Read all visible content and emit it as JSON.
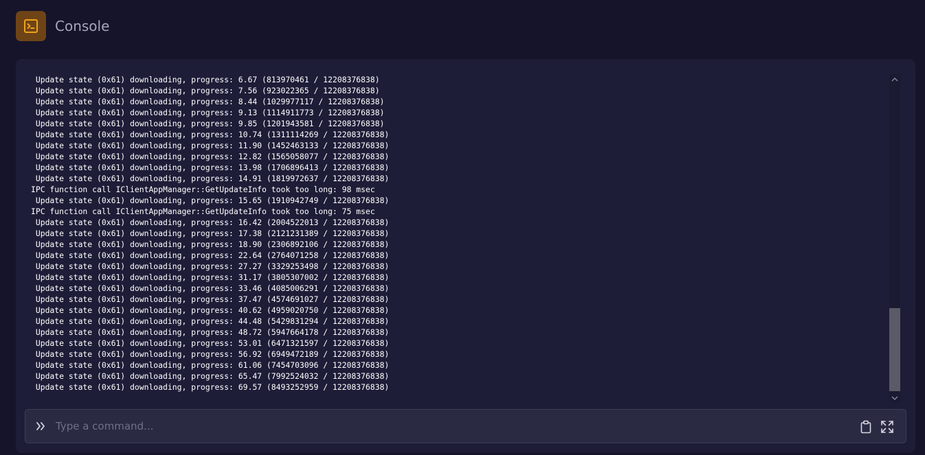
{
  "header": {
    "title": "Console",
    "icon": "terminal-icon"
  },
  "log": {
    "lines": [
      " Update state (0x61) downloading, progress: 6.67 (813970461 / 12208376838)",
      " Update state (0x61) downloading, progress: 7.56 (923022365 / 12208376838)",
      " Update state (0x61) downloading, progress: 8.44 (1029977117 / 12208376838)",
      " Update state (0x61) downloading, progress: 9.13 (1114911773 / 12208376838)",
      " Update state (0x61) downloading, progress: 9.85 (1201943581 / 12208376838)",
      " Update state (0x61) downloading, progress: 10.74 (1311114269 / 12208376838)",
      " Update state (0x61) downloading, progress: 11.90 (1452463133 / 12208376838)",
      " Update state (0x61) downloading, progress: 12.82 (1565058077 / 12208376838)",
      " Update state (0x61) downloading, progress: 13.98 (1706896413 / 12208376838)",
      " Update state (0x61) downloading, progress: 14.91 (1819972637 / 12208376838)",
      "IPC function call IClientAppManager::GetUpdateInfo took too long: 98 msec",
      " Update state (0x61) downloading, progress: 15.65 (1910942749 / 12208376838)",
      "IPC function call IClientAppManager::GetUpdateInfo took too long: 75 msec",
      " Update state (0x61) downloading, progress: 16.42 (2004522013 / 12208376838)",
      " Update state (0x61) downloading, progress: 17.38 (2121231389 / 12208376838)",
      " Update state (0x61) downloading, progress: 18.90 (2306892106 / 12208376838)",
      " Update state (0x61) downloading, progress: 22.64 (2764071258 / 12208376838)",
      " Update state (0x61) downloading, progress: 27.27 (3329253498 / 12208376838)",
      " Update state (0x61) downloading, progress: 31.17 (3805307002 / 12208376838)",
      " Update state (0x61) downloading, progress: 33.46 (4085006291 / 12208376838)",
      " Update state (0x61) downloading, progress: 37.47 (4574691027 / 12208376838)",
      " Update state (0x61) downloading, progress: 40.62 (4959020750 / 12208376838)",
      " Update state (0x61) downloading, progress: 44.48 (5429831294 / 12208376838)",
      " Update state (0x61) downloading, progress: 48.72 (5947664178 / 12208376838)",
      " Update state (0x61) downloading, progress: 53.01 (6471321597 / 12208376838)",
      " Update state (0x61) downloading, progress: 56.92 (6949472189 / 12208376838)",
      " Update state (0x61) downloading, progress: 61.06 (7454703096 / 12208376838)",
      " Update state (0x61) downloading, progress: 65.47 (7992524032 / 12208376838)",
      " Update state (0x61) downloading, progress: 69.57 (8493252959 / 12208376838)"
    ]
  },
  "command": {
    "placeholder": "Type a command...",
    "value": ""
  },
  "icons": {
    "prompt": "chevrons-right-icon",
    "clipboard": "clipboard-icon",
    "fullscreen": "expand-icon"
  },
  "colors": {
    "accent": "#f0a21c",
    "background": "#15142a",
    "panel": "#1d1d38"
  }
}
